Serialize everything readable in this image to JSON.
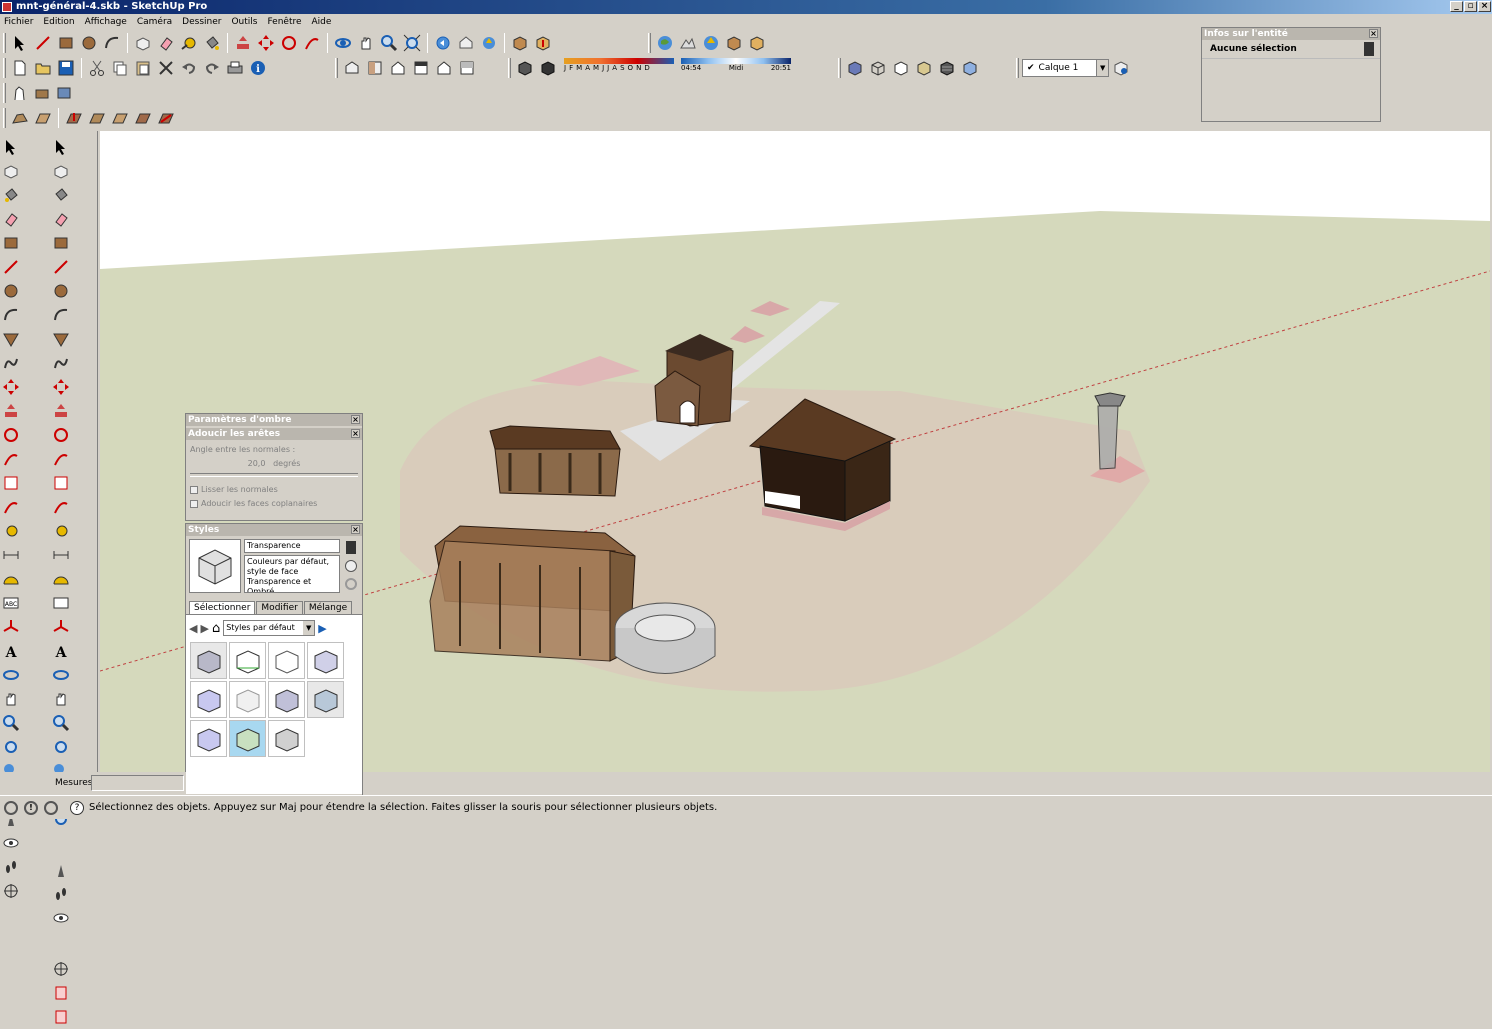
{
  "window": {
    "title": "mnt-général-4.skb - SketchUp Pro"
  },
  "menu": [
    "Fichier",
    "Edition",
    "Affichage",
    "Caméra",
    "Dessiner",
    "Outils",
    "Fenêtre",
    "Aide"
  ],
  "shadow_bar": {
    "months": "J F M A M J J A S O N D",
    "time_start": "04:54",
    "time_mid": "Midi",
    "time_end": "20:51"
  },
  "layer": {
    "label": "Calque 1"
  },
  "entity_info": {
    "title": "Infos sur l'entité",
    "selection": "Aucune sélection"
  },
  "shadow_panel": {
    "title": "Paramètres d'ombre"
  },
  "soften_panel": {
    "title": "Adoucir les arêtes",
    "angle_label": "Angle entre les normales :",
    "angle_value": "20,0",
    "angle_unit": "degrés",
    "smooth_normals": "Lisser les normales",
    "soften_coplanar": "Adoucir les faces coplanaires"
  },
  "styles_panel": {
    "title": "Styles",
    "style_name": "Transparence",
    "style_desc": "Couleurs par défaut, style de face Transparence et Ombré",
    "tabs": [
      "Sélectionner",
      "Modifier",
      "Mélange"
    ],
    "dropdown": "Styles par défaut"
  },
  "measurements": {
    "label": "Mesures",
    "value": ""
  },
  "status": {
    "text": "Sélectionnez des objets. Appuyez sur Maj pour étendre la sélection. Faites glisser la souris pour sélectionner plusieurs objets."
  },
  "colors": {
    "sky": "#ffffff",
    "ground": "#d5d9bc",
    "courtyard": "#d9ccbb",
    "wood": "#6b4a30"
  }
}
